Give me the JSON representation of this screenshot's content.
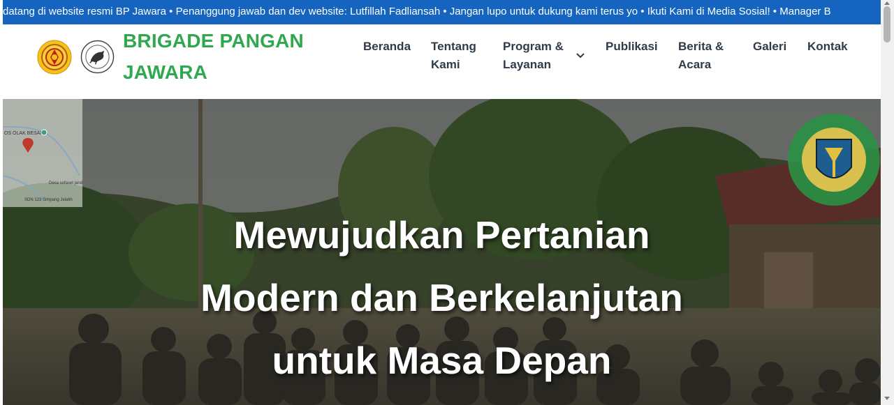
{
  "ticker": {
    "text": "datang di website resmi BP Jawara • Penanggung jawab dan dev website: Lutfillah Fadliansah • Jangan lupo untuk dukung kami terus yo • Ikuti Kami di Media Sosial! • Manager B"
  },
  "header": {
    "brand_line1": "BRIGADE PANGAN",
    "brand_line2": "JAWARA"
  },
  "nav": {
    "beranda": "Beranda",
    "tentang_1": "Tentang",
    "tentang_2": "Kami",
    "program_1": "Program &",
    "program_2": "Layanan",
    "publikasi": "Publikasi",
    "berita_1": "Berita &",
    "berita_2": "Acara",
    "galeri": "Galeri",
    "kontak": "Kontak"
  },
  "hero": {
    "line1": "Mewujudkan Pertanian",
    "line2": "Modern dan Berkelanjutan",
    "line3": "untuk Masa Depan",
    "map_label_top": "OS OLAK BESAR",
    "map_label_mid": "Desa sofaset jand",
    "map_label_bottom": "SDN 123 Simpang Jelatih"
  },
  "colors": {
    "ticker_bg": "#1565c0",
    "brand_green": "#2fa84f",
    "nav_text": "#2f3b4a"
  },
  "icons": {
    "nav_dropdown": "chevron-down-icon",
    "logo_left": "government-crest-icon",
    "logo_right": "tiger-emblem-icon",
    "map_pin": "map-pin-icon",
    "seal": "dinas-pertanian-seal-icon"
  }
}
